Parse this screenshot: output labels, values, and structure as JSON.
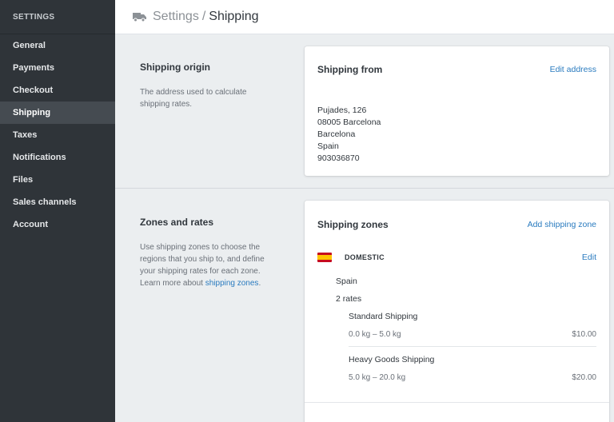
{
  "sidebar": {
    "header": "SETTINGS",
    "items": [
      {
        "label": "General"
      },
      {
        "label": "Payments"
      },
      {
        "label": "Checkout"
      },
      {
        "label": "Shipping",
        "active": true
      },
      {
        "label": "Taxes"
      },
      {
        "label": "Notifications"
      },
      {
        "label": "Files"
      },
      {
        "label": "Sales channels"
      },
      {
        "label": "Account"
      }
    ]
  },
  "topbar": {
    "icon": "truck-icon",
    "breadcrumb_parent": "Settings",
    "breadcrumb_separator": "/",
    "breadcrumb_current": "Shipping"
  },
  "origin_section": {
    "title": "Shipping origin",
    "description": "The address used to calculate shipping rates.",
    "card": {
      "title": "Shipping from",
      "action": "Edit address",
      "address": [
        "Pujades, 126",
        "08005 Barcelona",
        "Barcelona",
        "Spain",
        "903036870"
      ]
    }
  },
  "zones_section": {
    "title": "Zones and rates",
    "description": "Use shipping zones to choose the regions that you ship to, and define your shipping rates for each zone. Learn more about ",
    "link": "shipping zones",
    "description_end": ".",
    "card": {
      "title": "Shipping zones",
      "action": "Add shipping zone",
      "zone": {
        "flag": "spain-flag",
        "name": "DOMESTIC",
        "edit": "Edit",
        "country": "Spain",
        "rate_count": "2 rates",
        "rates": [
          {
            "name": "Standard Shipping",
            "range": "0.0 kg – 5.0 kg",
            "price": "$10.00"
          },
          {
            "name": "Heavy Goods Shipping",
            "range": "5.0 kg – 20.0 kg",
            "price": "$20.00"
          }
        ]
      }
    }
  },
  "colors": {
    "sidebar_bg": "#2f3439",
    "sidebar_active": "#454b51",
    "link": "#2a7bbf",
    "page_bg": "#ebeef0"
  }
}
